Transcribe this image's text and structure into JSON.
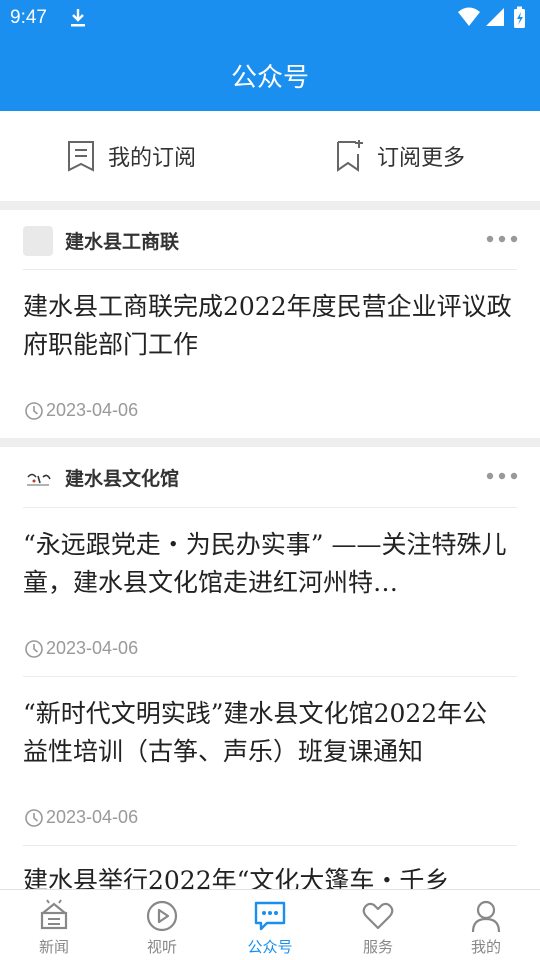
{
  "status": {
    "time": "9:47"
  },
  "appbar": {
    "title": "公众号"
  },
  "subscription": {
    "mine_label": "我的订阅",
    "more_label": "订阅更多"
  },
  "feeds": [
    {
      "account": "建水县工商联",
      "articles": [
        {
          "title": "建水县工商联完成2022年度民营企业评议政府职能部门工作",
          "date": "2023-04-06"
        }
      ]
    },
    {
      "account": "建水县文化馆",
      "articles": [
        {
          "title": "“永远跟党走・为民办实事” ——关注特殊儿童，建水县文化馆走进红河州特…",
          "date": "2023-04-06"
        },
        {
          "title": "“新时代文明实践”建水县文化馆2022年公益性培训（古筝、声乐）班复课通知",
          "date": "2023-04-06"
        },
        {
          "title": "建水县举行2022年“文化大篷车・千乡",
          "date": ""
        }
      ]
    }
  ],
  "tabbar": {
    "items": [
      {
        "label": "新闻",
        "icon": "news-icon"
      },
      {
        "label": "视听",
        "icon": "play-icon"
      },
      {
        "label": "公众号",
        "icon": "chat-icon"
      },
      {
        "label": "服务",
        "icon": "heart-icon"
      },
      {
        "label": "我的",
        "icon": "user-icon"
      }
    ],
    "active_index": 2
  },
  "colors": {
    "primary": "#1a8ff0",
    "text": "#222222",
    "muted": "#999999",
    "separator": "#eeeeee"
  }
}
